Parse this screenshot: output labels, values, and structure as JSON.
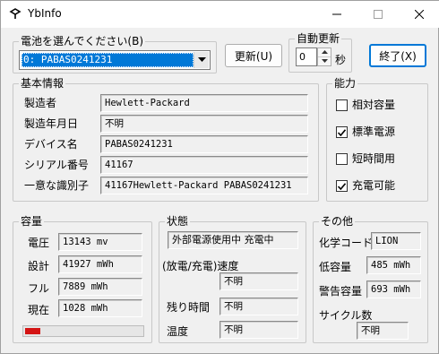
{
  "window": {
    "title": "YbInfo",
    "controls": {
      "minimize": "minimize-icon",
      "maximize": "maximize-icon",
      "close": "close-icon"
    }
  },
  "battery_select": {
    "label": "電池を選んでください(B)",
    "selected": "0: PABAS0241231"
  },
  "buttons": {
    "refresh": "更新(U)",
    "exit": "終了(X)"
  },
  "auto_refresh": {
    "label": "自動更新",
    "value": "0",
    "unit": "秒"
  },
  "basic_info": {
    "title": "基本情報",
    "rows": [
      {
        "label": "製造者",
        "value": "Hewlett-Packard"
      },
      {
        "label": "製造年月日",
        "value": "不明"
      },
      {
        "label": "デバイス名",
        "value": "PABAS0241231"
      },
      {
        "label": "シリアル番号",
        "value": "41167"
      },
      {
        "label": "一意な識別子",
        "value": "41167Hewlett-Packard PABAS0241231"
      }
    ]
  },
  "capabilities": {
    "title": "能力",
    "items": [
      {
        "label": "相対容量",
        "checked": false
      },
      {
        "label": "標準電源",
        "checked": true
      },
      {
        "label": "短時間用",
        "checked": false
      },
      {
        "label": "充電可能",
        "checked": true
      }
    ]
  },
  "capacity": {
    "title": "容量",
    "rows": [
      {
        "label": "電圧",
        "value": "13143 mv"
      },
      {
        "label": "設計",
        "value": "41927 mWh"
      },
      {
        "label": "フル",
        "value": "7889 mWh"
      },
      {
        "label": "現在",
        "value": "1028 mWh"
      }
    ],
    "charge_fraction": 0.13,
    "bar_color": "#d41414"
  },
  "status": {
    "title": "状態",
    "power_state": "外部電源使用中 充電中",
    "rate_label": "(放電/充電)速度",
    "rate_value": "不明",
    "remaining_label": "残り時間",
    "remaining_value": "不明",
    "temp_label": "温度",
    "temp_value": "不明"
  },
  "other": {
    "title": "その他",
    "chemistry_label": "化学コード",
    "chemistry_value": "LION",
    "low_label": "低容量",
    "low_value": "485 mWh",
    "warn_label": "警告容量",
    "warn_value": "693 mWh",
    "cycle_label": "サイクル数",
    "cycle_value": "不明"
  },
  "colors": {
    "accent": "#0078d7"
  }
}
